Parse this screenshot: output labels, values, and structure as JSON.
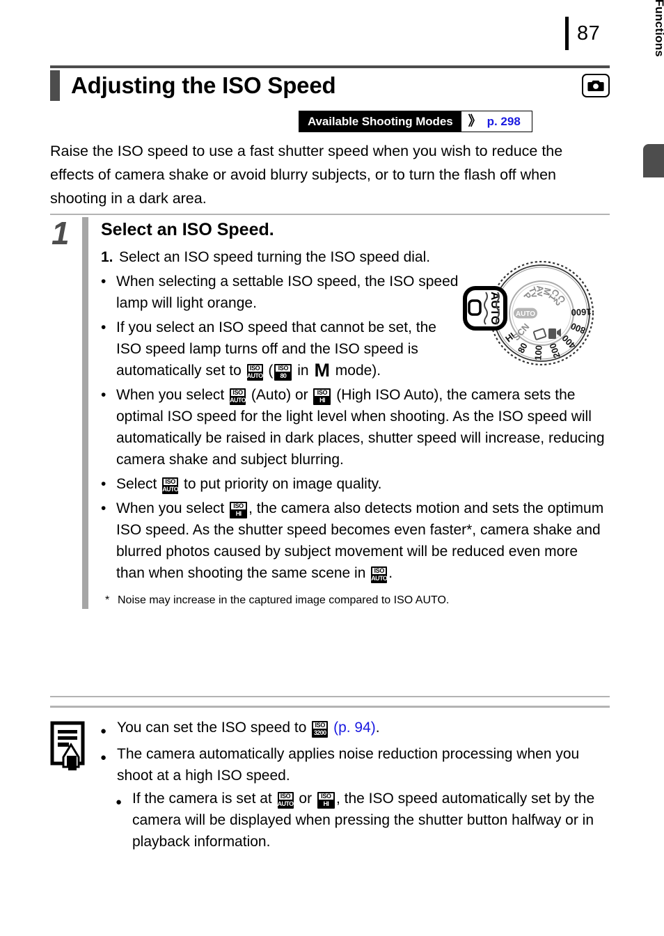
{
  "page": {
    "number": "87",
    "side_tab_label": "Commonly Used Shooting Functions"
  },
  "header": {
    "title": "Adjusting the ISO Speed",
    "camera_icon": "camera-icon",
    "modes_badge": {
      "label": "Available Shooting Modes",
      "chevron": "》",
      "page_ref": "p. 298"
    }
  },
  "intro": "Raise the ISO speed to use a fast shutter speed when you wish to reduce the effects of camera shake or avoid blurry subjects, or to turn the flash off when shooting in a dark area.",
  "step": {
    "number": "1",
    "title": "Select an ISO Speed.",
    "numbered_items": [
      {
        "marker": "1.",
        "text": "Select an ISO speed turning the ISO speed dial."
      }
    ],
    "bullets": [
      {
        "dot": "•",
        "parts": [
          {
            "type": "text",
            "text": "When selecting a settable ISO speed, the ISO speed lamp will light orange."
          }
        ]
      },
      {
        "dot": "•",
        "parts": [
          {
            "type": "text",
            "text": "If you select an ISO speed that cannot be set, the ISO speed lamp turns off and the ISO speed is automatically set to "
          },
          {
            "type": "iso",
            "top": "ISO",
            "value": "AUTO"
          },
          {
            "type": "text",
            "text": " ("
          },
          {
            "type": "iso",
            "top": "ISO",
            "value": "80"
          },
          {
            "type": "text",
            "text": " in "
          },
          {
            "type": "mode",
            "text": "M"
          },
          {
            "type": "text",
            "text": " mode)."
          }
        ]
      },
      {
        "dot": "•",
        "parts": [
          {
            "type": "text",
            "text": "When you select "
          },
          {
            "type": "iso",
            "top": "ISO",
            "value": "AUTO"
          },
          {
            "type": "text",
            "text": " (Auto) or "
          },
          {
            "type": "iso",
            "top": "ISO",
            "value": "HI"
          },
          {
            "type": "text",
            "text": " (High ISO Auto), the camera sets the optimal ISO speed for the light level when shooting. As the ISO speed will automatically be raised in dark places, shutter speed will increase, reducing camera shake and subject blurring."
          }
        ]
      },
      {
        "dot": "•",
        "parts": [
          {
            "type": "text",
            "text": "Select "
          },
          {
            "type": "iso",
            "top": "ISO",
            "value": "AUTO"
          },
          {
            "type": "text",
            "text": " to put priority on image quality."
          }
        ]
      },
      {
        "dot": "•",
        "parts": [
          {
            "type": "text",
            "text": "When you select "
          },
          {
            "type": "iso",
            "top": "ISO",
            "value": "HI"
          },
          {
            "type": "text",
            "text": ", the camera also detects motion and sets the optimum ISO speed. As the shutter speed becomes even faster*, camera shake and blurred photos caused by subject movement will be reduced even more than when shooting the same scene in "
          },
          {
            "type": "iso",
            "top": "ISO",
            "value": "AUTO"
          },
          {
            "type": "text",
            "text": "."
          }
        ]
      }
    ],
    "footnote": {
      "mark": "*",
      "text": "Noise may increase in the captured image compared to ISO AUTO."
    }
  },
  "notes": {
    "icon": "note-pencil-icon",
    "items": [
      {
        "dot": "●",
        "parts": [
          {
            "type": "text",
            "text": "You can set the ISO speed to "
          },
          {
            "type": "iso",
            "top": "ISO",
            "value": "3200"
          },
          {
            "type": "link",
            "text": " (p. 94)"
          },
          {
            "type": "text",
            "text": "."
          }
        ]
      },
      {
        "dot": "●",
        "parts": [
          {
            "type": "text",
            "text": "The camera automatically applies noise reduction processing when you shoot at a high ISO speed."
          }
        ]
      },
      {
        "dot": "●",
        "indent": true,
        "parts": [
          {
            "type": "text",
            "text": "If the camera is set at "
          },
          {
            "type": "iso",
            "top": "ISO",
            "value": "AUTO"
          },
          {
            "type": "text",
            "text": " or "
          },
          {
            "type": "iso",
            "top": "ISO",
            "value": "HI"
          },
          {
            "type": "text",
            "text": ", the ISO speed automatically set by the camera will be displayed when pressing the shutter button halfway or in playback information."
          }
        ]
      }
    ]
  },
  "dial": {
    "name": "iso-speed-dial-illustration",
    "callout_label": "AUTO",
    "iso_ring_labels": [
      "HI",
      "80",
      "100",
      "200",
      "400",
      "800",
      "1600"
    ],
    "mode_labels": [
      "P",
      "Tv",
      "Av",
      "M",
      "C1",
      "C2"
    ],
    "inner_auto_label": "AUTO",
    "inner_scene_label": "SCN"
  },
  "colors": {
    "accent_gray": "#4d4d4d",
    "rule_gray": "#b3b3b3",
    "link_blue": "#1a1ae0"
  }
}
